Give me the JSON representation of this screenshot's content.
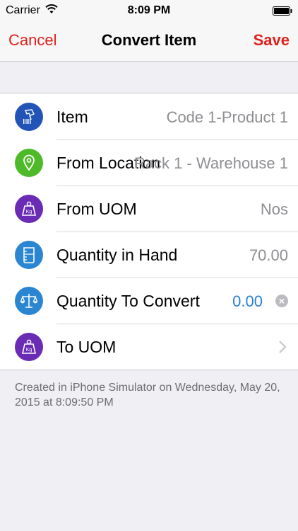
{
  "status_bar": {
    "carrier": "Carrier",
    "time": "8:09 PM"
  },
  "nav": {
    "cancel_label": "Cancel",
    "title": "Convert Item",
    "save_label": "Save"
  },
  "rows": [
    {
      "label": "Item",
      "value": "Code 1-Product 1",
      "icon": "barcode-scanner-icon",
      "icon_color": "#2254b8"
    },
    {
      "label": "From Location",
      "value": "Rack 1 - Warehouse 1",
      "icon": "location-pin-icon",
      "icon_color": "#4fba29"
    },
    {
      "label": "From UOM",
      "value": "Nos",
      "icon": "weight-kg-icon",
      "icon_color": "#6a2bb5"
    },
    {
      "label": "Quantity in Hand",
      "value": "70.00",
      "icon": "measuring-beaker-icon",
      "icon_color": "#2a86d1"
    },
    {
      "label": "Quantity To Convert",
      "value": "0.00",
      "icon": "scale-balance-icon",
      "icon_color": "#2a86d1"
    },
    {
      "label": "To UOM",
      "value": "",
      "icon": "weight-kg-icon",
      "icon_color": "#6a2bb5"
    }
  ],
  "footer": {
    "note": "Created in iPhone Simulator on Wednesday, May 20, 2015 at 8:09:50 PM"
  },
  "colors": {
    "accent": "#e0211b",
    "value_blue": "#2a7fd6"
  }
}
